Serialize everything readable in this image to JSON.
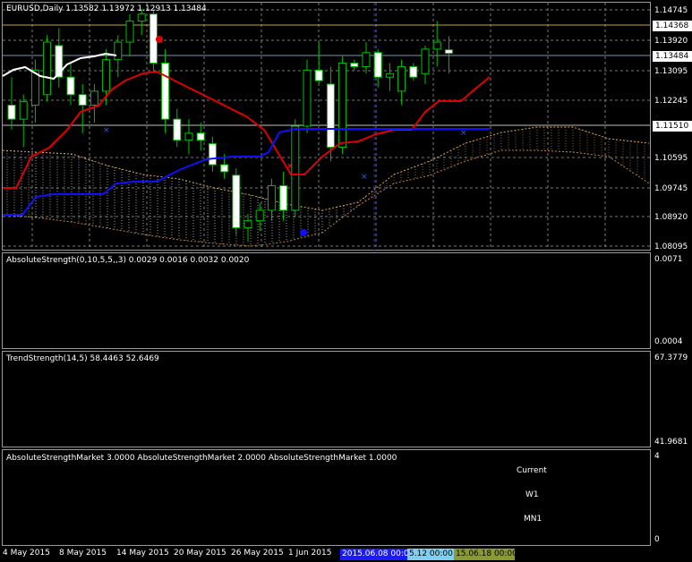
{
  "main": {
    "info": "EURUSD,Daily  1.13582 1.13972 1.12913 1.13484",
    "price_axis": [
      "1.14745",
      "1.14368",
      "1.13920",
      "1.13484",
      "1.13095",
      "1.12245",
      "1.11510",
      "1.10595",
      "1.09745",
      "1.08920",
      "1.08095"
    ],
    "current_price": "1.13484",
    "level_price": "1.11510",
    "orange_level": "1.14368"
  },
  "abs_strength": {
    "title": "AbsoluteStrength(0,10,5,5,,3) 0.0029 0.0016 0.0032 0.0020",
    "axis_top": "0.0071",
    "axis_bottom": "0.0004"
  },
  "trend_strength": {
    "title": "TrendStrength(14,5) 58.4463 52.6469",
    "axis_top": "67.3779",
    "axis_bottom": "41.9681"
  },
  "asm": {
    "title": "AbsoluteStrengthMarket 3.0000  AbsoluteStrengthMarket 2.0000  AbsoluteStrengthMarket 1.0000",
    "axis_top": "4",
    "axis_bottom": "0",
    "row_labels": [
      "Current",
      "W1",
      "MN1"
    ],
    "colors": {
      "yellow": "#ffff00",
      "blue": "#0000ff",
      "red": "#ff0000",
      "orange": "#ff8c00",
      "white": "#ffffff",
      "lightblue": "#add8e6"
    },
    "rows": [
      [
        "yellow",
        "yellow",
        "yellow",
        "orange",
        "yellow",
        "blue",
        "blue",
        "blue",
        "blue",
        "blue",
        "blue",
        "blue",
        "red",
        "red",
        "red",
        "red",
        "red",
        "blue",
        "orange",
        "orange",
        "orange",
        "orange",
        "orange",
        "yellow",
        "yellow",
        "blue",
        "white",
        "white",
        "white",
        "white",
        "white",
        "white",
        "white",
        "white"
      ],
      [
        "blue",
        "blue",
        "blue",
        "blue",
        "blue",
        "blue",
        "blue",
        "blue",
        "blue",
        "blue",
        "blue",
        "blue",
        "blue",
        "blue",
        "orange",
        "orange",
        "blue",
        "blue",
        "orange",
        "orange",
        "orange",
        "orange",
        "orange",
        "blue",
        "blue",
        "blue",
        "white",
        "white",
        "white",
        "white",
        "white",
        "white",
        "white",
        "white"
      ],
      [
        "yellow",
        "yellow",
        "yellow",
        "yellow",
        "yellow",
        "yellow",
        "yellow",
        "yellow",
        "yellow",
        "yellow",
        "yellow",
        "yellow",
        "yellow",
        "yellow",
        "yellow",
        "yellow",
        "yellow",
        "yellow",
        "yellow",
        "yellow",
        "lightblue",
        "lightblue",
        "lightblue",
        "lightblue",
        "lightblue",
        "lightblue",
        "lightblue",
        "lightblue",
        "lightblue",
        "lightblue",
        "lightblue",
        "lightblue",
        "lightblue",
        "lightblue"
      ]
    ]
  },
  "time_axis": {
    "labels": [
      "4 May 2015",
      "8 May 2015",
      "14 May 2015",
      "20 May 2015",
      "26 May 2015",
      "1 Jun 2015"
    ],
    "box1": "2015.06.08 00:00",
    "box2": "5.12 00:00",
    "box3": "15.06.18 00:00"
  },
  "chart_data": {
    "type": "candlestick",
    "symbol": "EURUSD",
    "timeframe": "Daily",
    "ohlc_last": {
      "open": 1.13582,
      "high": 1.13972,
      "low": 1.12913,
      "close": 1.13484
    },
    "ylim": [
      1.079,
      1.149
    ],
    "candles": [
      {
        "o": 1.12,
        "h": 1.128,
        "l": 1.113,
        "c": 1.116
      },
      {
        "o": 1.116,
        "h": 1.123,
        "l": 1.108,
        "c": 1.121
      },
      {
        "o": 1.12,
        "h": 1.133,
        "l": 1.115,
        "c": 1.13
      },
      {
        "o": 1.123,
        "h": 1.14,
        "l": 1.121,
        "c": 1.138
      },
      {
        "o": 1.137,
        "h": 1.142,
        "l": 1.125,
        "c": 1.128
      },
      {
        "o": 1.128,
        "h": 1.132,
        "l": 1.12,
        "c": 1.123
      },
      {
        "o": 1.123,
        "h": 1.126,
        "l": 1.112,
        "c": 1.12
      },
      {
        "o": 1.12,
        "h": 1.126,
        "l": 1.115,
        "c": 1.124
      },
      {
        "o": 1.124,
        "h": 1.136,
        "l": 1.12,
        "c": 1.133
      },
      {
        "o": 1.133,
        "h": 1.14,
        "l": 1.128,
        "c": 1.138
      },
      {
        "o": 1.138,
        "h": 1.146,
        "l": 1.134,
        "c": 1.144
      },
      {
        "o": 1.144,
        "h": 1.1475,
        "l": 1.14,
        "c": 1.146
      },
      {
        "o": 1.146,
        "h": 1.147,
        "l": 1.13,
        "c": 1.132
      },
      {
        "o": 1.132,
        "h": 1.136,
        "l": 1.112,
        "c": 1.116
      },
      {
        "o": 1.116,
        "h": 1.119,
        "l": 1.108,
        "c": 1.11
      },
      {
        "o": 1.11,
        "h": 1.116,
        "l": 1.106,
        "c": 1.112
      },
      {
        "o": 1.112,
        "h": 1.115,
        "l": 1.107,
        "c": 1.11
      },
      {
        "o": 1.109,
        "h": 1.111,
        "l": 1.101,
        "c": 1.103
      },
      {
        "o": 1.103,
        "h": 1.106,
        "l": 1.099,
        "c": 1.101
      },
      {
        "o": 1.1,
        "h": 1.102,
        "l": 1.083,
        "c": 1.085
      },
      {
        "o": 1.085,
        "h": 1.089,
        "l": 1.081,
        "c": 1.087
      },
      {
        "o": 1.087,
        "h": 1.092,
        "l": 1.084,
        "c": 1.09
      },
      {
        "o": 1.09,
        "h": 1.099,
        "l": 1.087,
        "c": 1.097
      },
      {
        "o": 1.097,
        "h": 1.101,
        "l": 1.087,
        "c": 1.09
      },
      {
        "o": 1.09,
        "h": 1.116,
        "l": 1.088,
        "c": 1.114
      },
      {
        "o": 1.114,
        "h": 1.133,
        "l": 1.112,
        "c": 1.13
      },
      {
        "o": 1.13,
        "h": 1.138,
        "l": 1.126,
        "c": 1.127
      },
      {
        "o": 1.126,
        "h": 1.131,
        "l": 1.104,
        "c": 1.108
      },
      {
        "o": 1.108,
        "h": 1.134,
        "l": 1.106,
        "c": 1.132
      },
      {
        "o": 1.132,
        "h": 1.133,
        "l": 1.13,
        "c": 1.131
      },
      {
        "o": 1.131,
        "h": 1.138,
        "l": 1.129,
        "c": 1.135
      },
      {
        "o": 1.135,
        "h": 1.136,
        "l": 1.125,
        "c": 1.128
      },
      {
        "o": 1.128,
        "h": 1.132,
        "l": 1.124,
        "c": 1.129
      },
      {
        "o": 1.124,
        "h": 1.133,
        "l": 1.12,
        "c": 1.131
      },
      {
        "o": 1.131,
        "h": 1.132,
        "l": 1.127,
        "c": 1.128
      },
      {
        "o": 1.129,
        "h": 1.137,
        "l": 1.126,
        "c": 1.136
      },
      {
        "o": 1.136,
        "h": 1.144,
        "l": 1.131,
        "c": 1.138
      },
      {
        "o": 1.1358,
        "h": 1.1397,
        "l": 1.1291,
        "c": 1.1348
      }
    ]
  }
}
